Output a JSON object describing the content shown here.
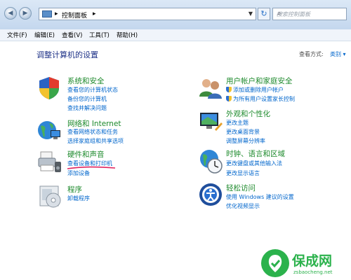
{
  "address": {
    "crumb": "控制面板",
    "search_placeholder": "搜索控制面板"
  },
  "menu": [
    "文件(F)",
    "编辑(E)",
    "查看(V)",
    "工具(T)",
    "帮助(H)"
  ],
  "heading": "调整计算机的设置",
  "view_by": {
    "label": "查看方式:",
    "value": "类别 ▾"
  },
  "categories": [
    {
      "title": "系统和安全",
      "links": [
        "查看您的计算机状态",
        "备份您的计算机",
        "查找并解决问题"
      ],
      "icon": "system-security-icon"
    },
    {
      "title": "网络和 Internet",
      "links": [
        "查看网络状态和任务",
        "选择家庭组和共享选项"
      ],
      "icon": "network-icon"
    },
    {
      "title": "硬件和声音",
      "links": [
        "查看设备和打印机",
        "添加设备"
      ],
      "icon": "hardware-printer-icon"
    },
    {
      "title": "程序",
      "links": [
        "卸载程序"
      ],
      "icon": "programs-icon"
    },
    {
      "title": "用户帐户和家庭安全",
      "links": [
        "添加或删除用户帐户",
        "为所有用户设置家长控制"
      ],
      "icon": "users-icon"
    },
    {
      "title": "外观和个性化",
      "links": [
        "更改主题",
        "更改桌面背景",
        "调整屏幕分辨率"
      ],
      "icon": "appearance-icon"
    },
    {
      "title": "时钟、语言和区域",
      "links": [
        "更改键盘或其他输入法",
        "更改显示语言"
      ],
      "icon": "clock-globe-icon"
    },
    {
      "title": "轻松访问",
      "links": [
        "使用 Windows 建议的设置",
        "优化视频显示"
      ],
      "icon": "ease-of-access-icon"
    }
  ],
  "watermark": {
    "text": "保成网",
    "url": "zsbaocheng.net"
  }
}
